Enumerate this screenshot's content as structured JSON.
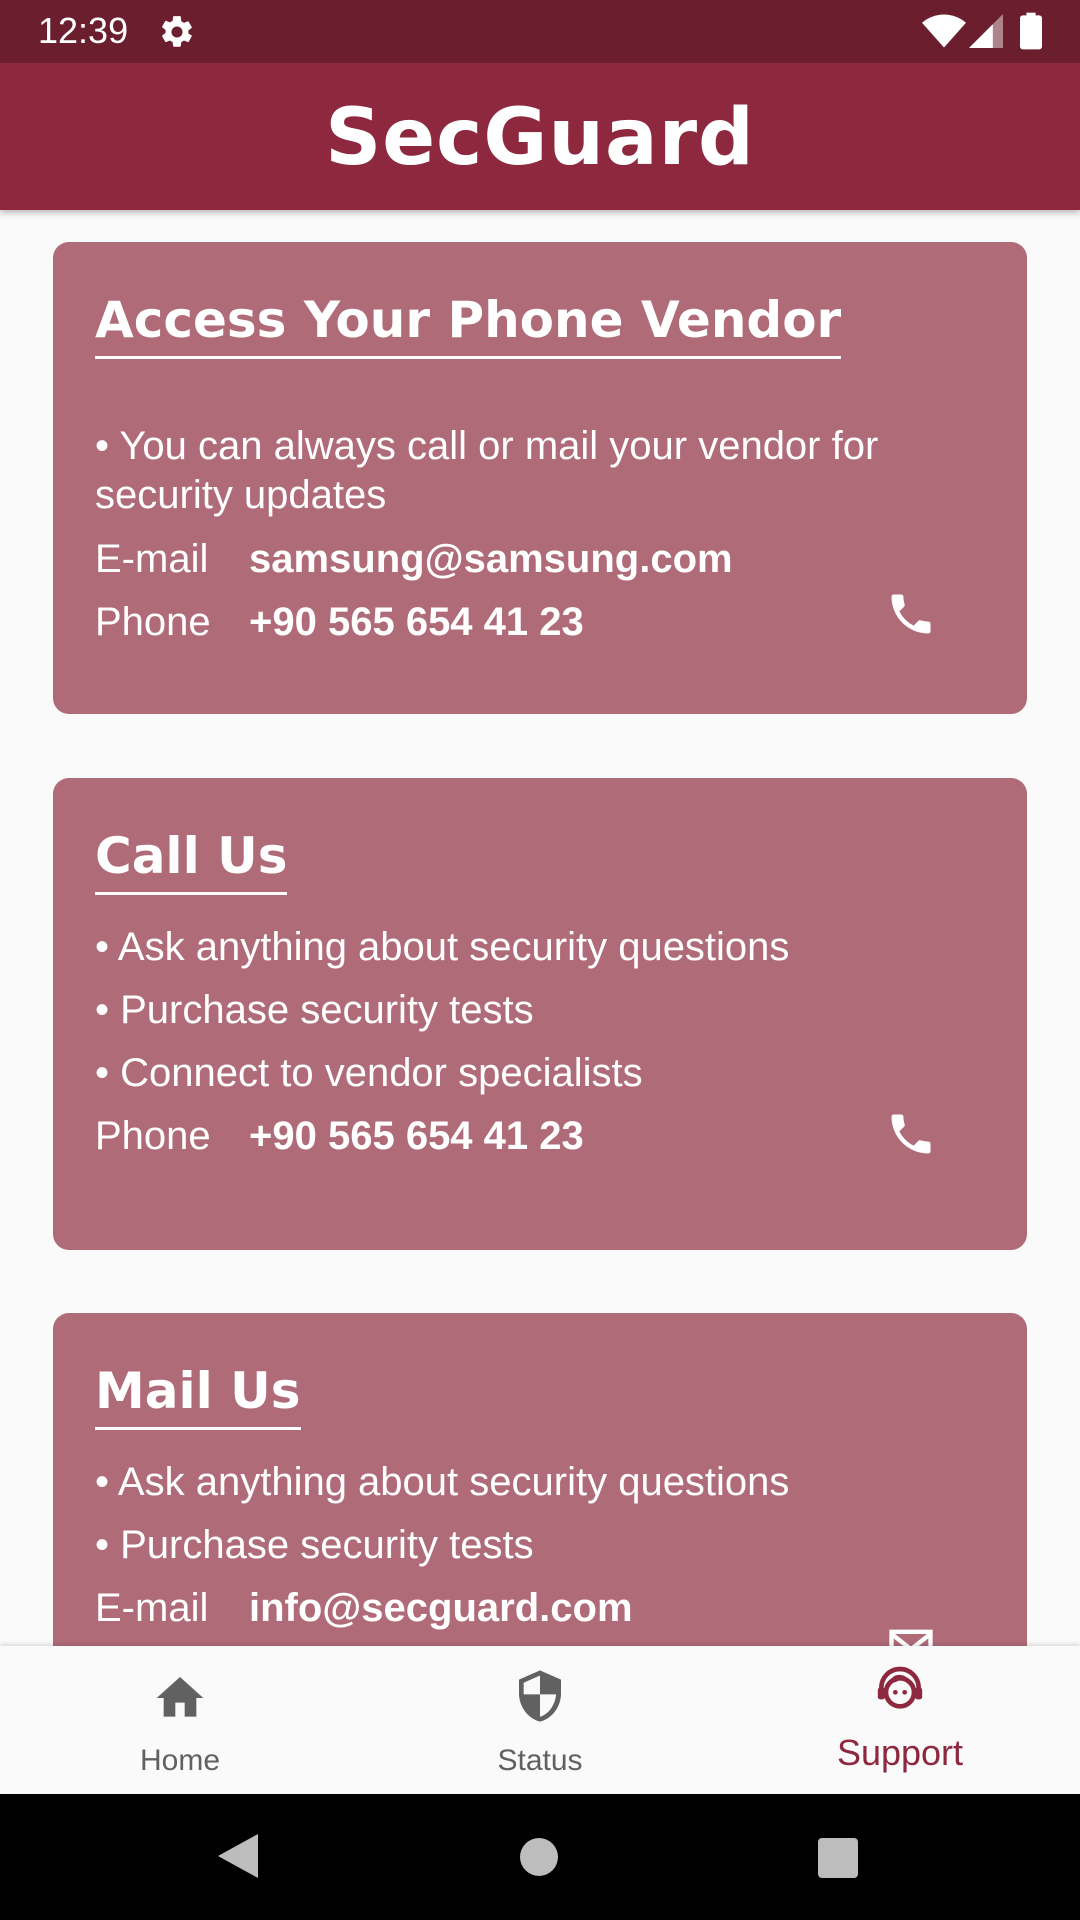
{
  "status_bar": {
    "time": "12:39"
  },
  "app_bar": {
    "title": "SecGuard"
  },
  "cards": {
    "vendor": {
      "title": "Access Your Phone Vendor",
      "bullets": [
        "You can always call or mail your vendor for security updates"
      ],
      "email_label": "E-mail",
      "email_value": "samsung@samsung.com",
      "phone_label": "Phone",
      "phone_value": "+90 565 654 41 23",
      "action_icon": "phone-icon"
    },
    "call_us": {
      "title": "Call Us",
      "bullets": [
        "Ask anything about security questions",
        "Purchase security tests",
        "Connect to vendor specialists"
      ],
      "phone_label": "Phone",
      "phone_value": "+90 565 654 41 23",
      "action_icon": "phone-icon"
    },
    "mail_us": {
      "title": "Mail Us",
      "bullets": [
        "Ask anything about security questions",
        "Purchase security tests"
      ],
      "email_label": "E-mail",
      "email_value": "info@secguard.com",
      "action_icon": "mail-icon"
    }
  },
  "bottom_nav": {
    "items": [
      {
        "label": "Home",
        "icon": "home-icon",
        "active": false
      },
      {
        "label": "Status",
        "icon": "shield-icon",
        "active": false
      },
      {
        "label": "Support",
        "icon": "support-agent-icon",
        "active": true
      }
    ]
  },
  "colors": {
    "status_bar": "#6b1f2e",
    "app_bar": "#8e283e",
    "card": "#b06b79",
    "nav_active": "#8e283e",
    "nav_inactive": "#616161"
  }
}
